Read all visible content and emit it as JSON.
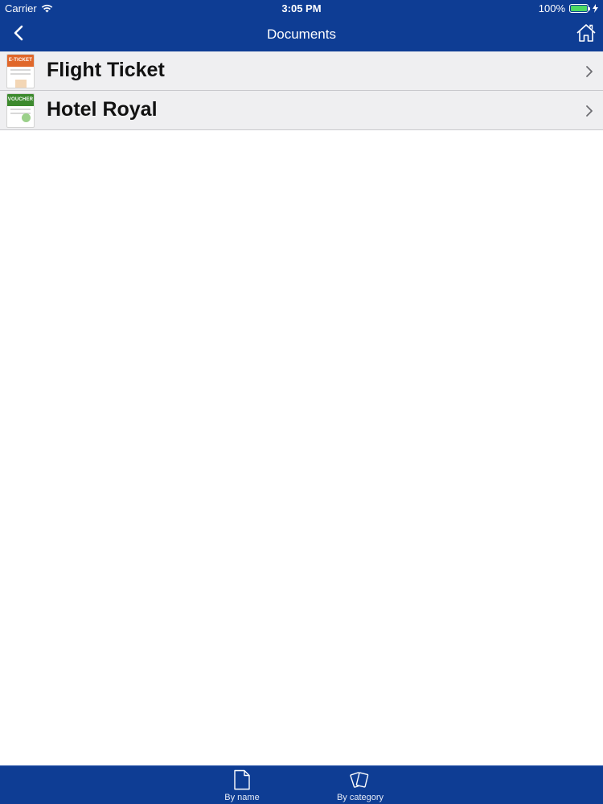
{
  "status_bar": {
    "carrier": "Carrier",
    "time": "3:05 PM",
    "battery": "100%",
    "battery_level": 1.0
  },
  "nav": {
    "title": "Documents",
    "back_icon": "chevron-left-icon",
    "home_icon": "home-icon"
  },
  "documents": [
    {
      "name": "Flight Ticket",
      "thumb_label": "E-TICKET",
      "thumb_color": "#e0672a"
    },
    {
      "name": "Hotel Royal",
      "thumb_label": "VOUCHER",
      "thumb_color": "#3d8a2e"
    }
  ],
  "tabs": [
    {
      "label": "By name",
      "icon": "document-icon"
    },
    {
      "label": "By category",
      "icon": "cards-icon"
    }
  ],
  "colors": {
    "bar": "#0e3d94",
    "row_bg": "#efeff1",
    "battery_fill": "#4cd964"
  }
}
